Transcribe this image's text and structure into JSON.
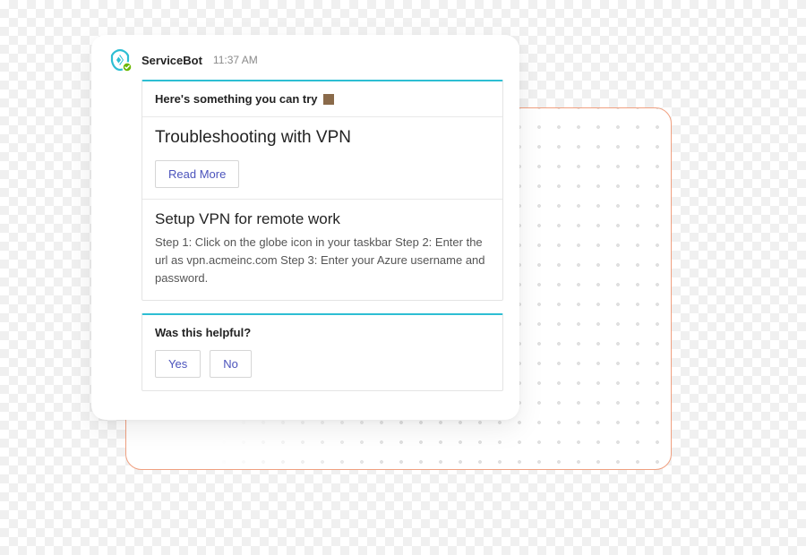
{
  "bot": {
    "name": "ServiceBot",
    "time": "11:37 AM"
  },
  "card1": {
    "prompt": "Here's something you can try",
    "title1": "Troubleshooting with VPN",
    "read_more": "Read More",
    "title2": "Setup VPN for remote work",
    "steps": "Step 1: Click on the globe icon in your taskbar Step 2: Enter the url as vpn.acmeinc.com Step 3: Enter your Azure username and password."
  },
  "card2": {
    "question": "Was this helpful?",
    "yes": "Yes",
    "no": "No"
  }
}
